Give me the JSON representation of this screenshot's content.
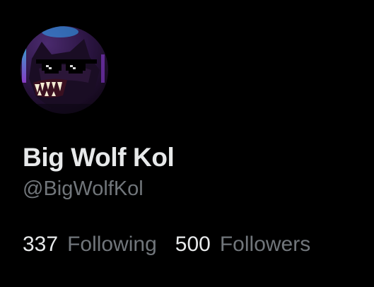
{
  "profile": {
    "display_name": "Big Wolf Kol",
    "handle": "@BigWolfKol",
    "avatar_icon": "wolf-with-pixel-sunglasses-avatar",
    "stats": {
      "following_count": "337",
      "following_label": "Following",
      "followers_count": "500",
      "followers_label": "Followers"
    }
  },
  "colors": {
    "background": "#000000",
    "primary_text": "#e7e9ea",
    "secondary_text": "#71767b"
  }
}
